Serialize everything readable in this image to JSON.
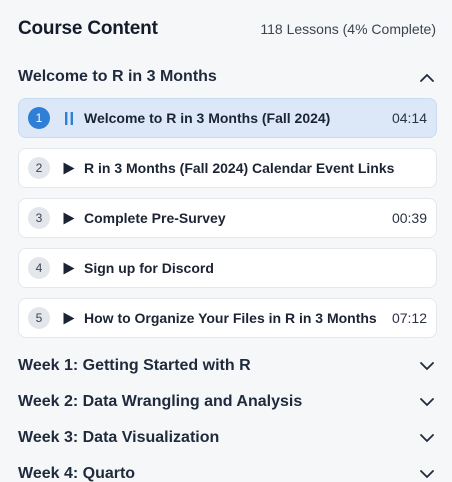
{
  "header": {
    "title": "Course Content",
    "progress": "118 Lessons (4% Complete)"
  },
  "open_section": {
    "title": "Welcome to R in 3 Months",
    "icon": "chevron-up-icon",
    "lessons": [
      {
        "number": "1",
        "title": "Welcome to R in 3 Months (Fall 2024)",
        "duration": "04:14",
        "state": "pause-icon",
        "active": true
      },
      {
        "number": "2",
        "title": "R in 3 Months (Fall 2024) Calendar Event Links",
        "duration": "",
        "state": "play-icon",
        "active": false
      },
      {
        "number": "3",
        "title": "Complete Pre-Survey",
        "duration": "00:39",
        "state": "play-icon",
        "active": false
      },
      {
        "number": "4",
        "title": "Sign up for Discord",
        "duration": "",
        "state": "play-icon",
        "active": false
      },
      {
        "number": "5",
        "title": "How to Organize Your Files in R in 3 Months",
        "duration": "07:12",
        "state": "play-icon",
        "active": false
      }
    ]
  },
  "sections": [
    {
      "title": "Week 1: Getting Started with R",
      "icon": "chevron-down-icon"
    },
    {
      "title": "Week 2: Data Wrangling and Analysis",
      "icon": "chevron-down-icon"
    },
    {
      "title": "Week 3: Data Visualization",
      "icon": "chevron-down-icon"
    },
    {
      "title": "Week 4: Quarto",
      "icon": "chevron-down-icon"
    }
  ],
  "colors": {
    "accent": "#2f7fd6",
    "active_row": "#dce8f7",
    "background": "#f6f7f9"
  }
}
